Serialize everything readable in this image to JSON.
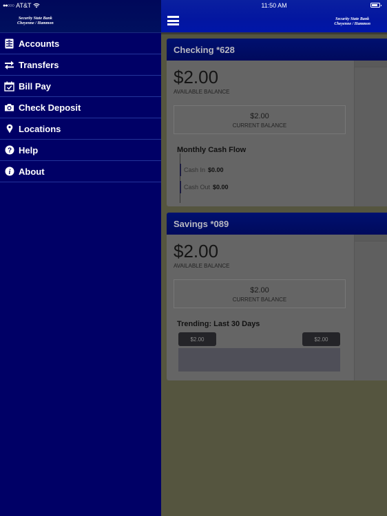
{
  "status_bar": {
    "signal_dots": "●●○○○",
    "carrier": "AT&T",
    "time": "11:50 AM"
  },
  "brand": {
    "line1": "Security State Bank",
    "line2": "Cheyenne / Hammon"
  },
  "sidebar": {
    "items": [
      {
        "label": "Accounts",
        "icon": "accounts-icon"
      },
      {
        "label": "Transfers",
        "icon": "transfers-icon"
      },
      {
        "label": "Bill Pay",
        "icon": "calendar-check-icon"
      },
      {
        "label": "Check Deposit",
        "icon": "camera-icon"
      },
      {
        "label": "Locations",
        "icon": "map-pin-icon"
      },
      {
        "label": "Help",
        "icon": "question-circle-icon"
      },
      {
        "label": "About",
        "icon": "info-circle-icon"
      }
    ]
  },
  "accounts": [
    {
      "title": "Checking *628",
      "available_amount": "$2.00",
      "available_label": "AVAILABLE BALANCE",
      "current_amount": "$2.00",
      "current_label": "CURRENT BALANCE",
      "section_title": "Monthly Cash Flow",
      "cash_in_label": "Cash In",
      "cash_in_value": "$0.00",
      "cash_out_label": "Cash Out",
      "cash_out_value": "$0.00"
    },
    {
      "title": "Savings *089",
      "available_amount": "$2.00",
      "available_label": "AVAILABLE BALANCE",
      "current_amount": "$2.00",
      "current_label": "CURRENT BALANCE",
      "section_title": "Trending: Last 30 Days",
      "trend_start": "$2.00",
      "trend_end": "$2.00"
    }
  ],
  "colors": {
    "sidebar_bg": "#000066",
    "header_bg": "#0316a0",
    "card_header": "#000a5c",
    "overlay_bg": "#55553f"
  }
}
